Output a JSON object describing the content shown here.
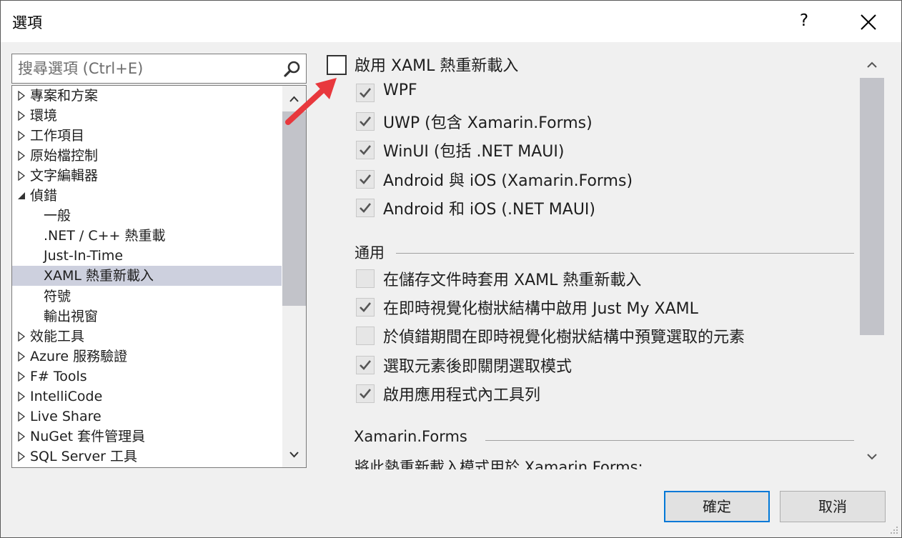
{
  "window": {
    "title": "選項",
    "help_label": "?"
  },
  "search": {
    "placeholder": "搜尋選項 (Ctrl+E)"
  },
  "tree": {
    "items": [
      {
        "label": "專案和方案",
        "expander": "collapsed"
      },
      {
        "label": "環境",
        "expander": "collapsed"
      },
      {
        "label": "工作項目",
        "expander": "collapsed"
      },
      {
        "label": "原始檔控制",
        "expander": "collapsed"
      },
      {
        "label": "文字編輯器",
        "expander": "collapsed"
      },
      {
        "label": "偵錯",
        "expander": "expanded"
      },
      {
        "label": "一般",
        "expander": "none"
      },
      {
        "label": ".NET / C++ 熱重載",
        "expander": "none"
      },
      {
        "label": "Just-In-Time",
        "expander": "none"
      },
      {
        "label": "XAML 熱重新載入",
        "expander": "none",
        "selected": true
      },
      {
        "label": "符號",
        "expander": "none"
      },
      {
        "label": "輸出視窗",
        "expander": "none"
      },
      {
        "label": "效能工具",
        "expander": "collapsed"
      },
      {
        "label": "Azure 服務驗證",
        "expander": "collapsed"
      },
      {
        "label": "F# Tools",
        "expander": "collapsed"
      },
      {
        "label": "IntelliCode",
        "expander": "collapsed"
      },
      {
        "label": "Live Share",
        "expander": "collapsed"
      },
      {
        "label": "NuGet 套件管理員",
        "expander": "collapsed"
      },
      {
        "label": "SQL Server 工具",
        "expander": "collapsed"
      }
    ]
  },
  "options": {
    "enable_hot_reload": {
      "label": "啟用 XAML 熱重新載入",
      "checked": false
    },
    "platforms": [
      {
        "label": "WPF",
        "checked": true
      },
      {
        "label": "UWP (包含 Xamarin.Forms)",
        "checked": true
      },
      {
        "label": "WinUI (包括 .NET MAUI)",
        "checked": true
      },
      {
        "label": "Android 與 iOS (Xamarin.Forms)",
        "checked": true
      },
      {
        "label": "Android 和 iOS (.NET MAUI)",
        "checked": true
      }
    ],
    "general_section": "通用",
    "general": [
      {
        "label": "在儲存文件時套用 XAML 熱重新載入",
        "checked": false
      },
      {
        "label": "在即時視覺化樹狀結構中啟用 Just My XAML",
        "checked": true
      },
      {
        "label": "於偵錯期間在即時視覺化樹狀結構中預覽選取的元素",
        "checked": false
      },
      {
        "label": "選取元素後即關閉選取模式",
        "checked": true
      },
      {
        "label": "啟用應用程式內工具列",
        "checked": true
      }
    ],
    "xamarin_section": "Xamarin.Forms",
    "xamarin_text": "將此熱重新載入模式用於 Xamarin.Forms:"
  },
  "buttons": {
    "ok": "確定",
    "cancel": "取消"
  },
  "colors": {
    "accent": "#0078d7",
    "selection": "#cdd0de",
    "pointer": "#e8383d"
  }
}
